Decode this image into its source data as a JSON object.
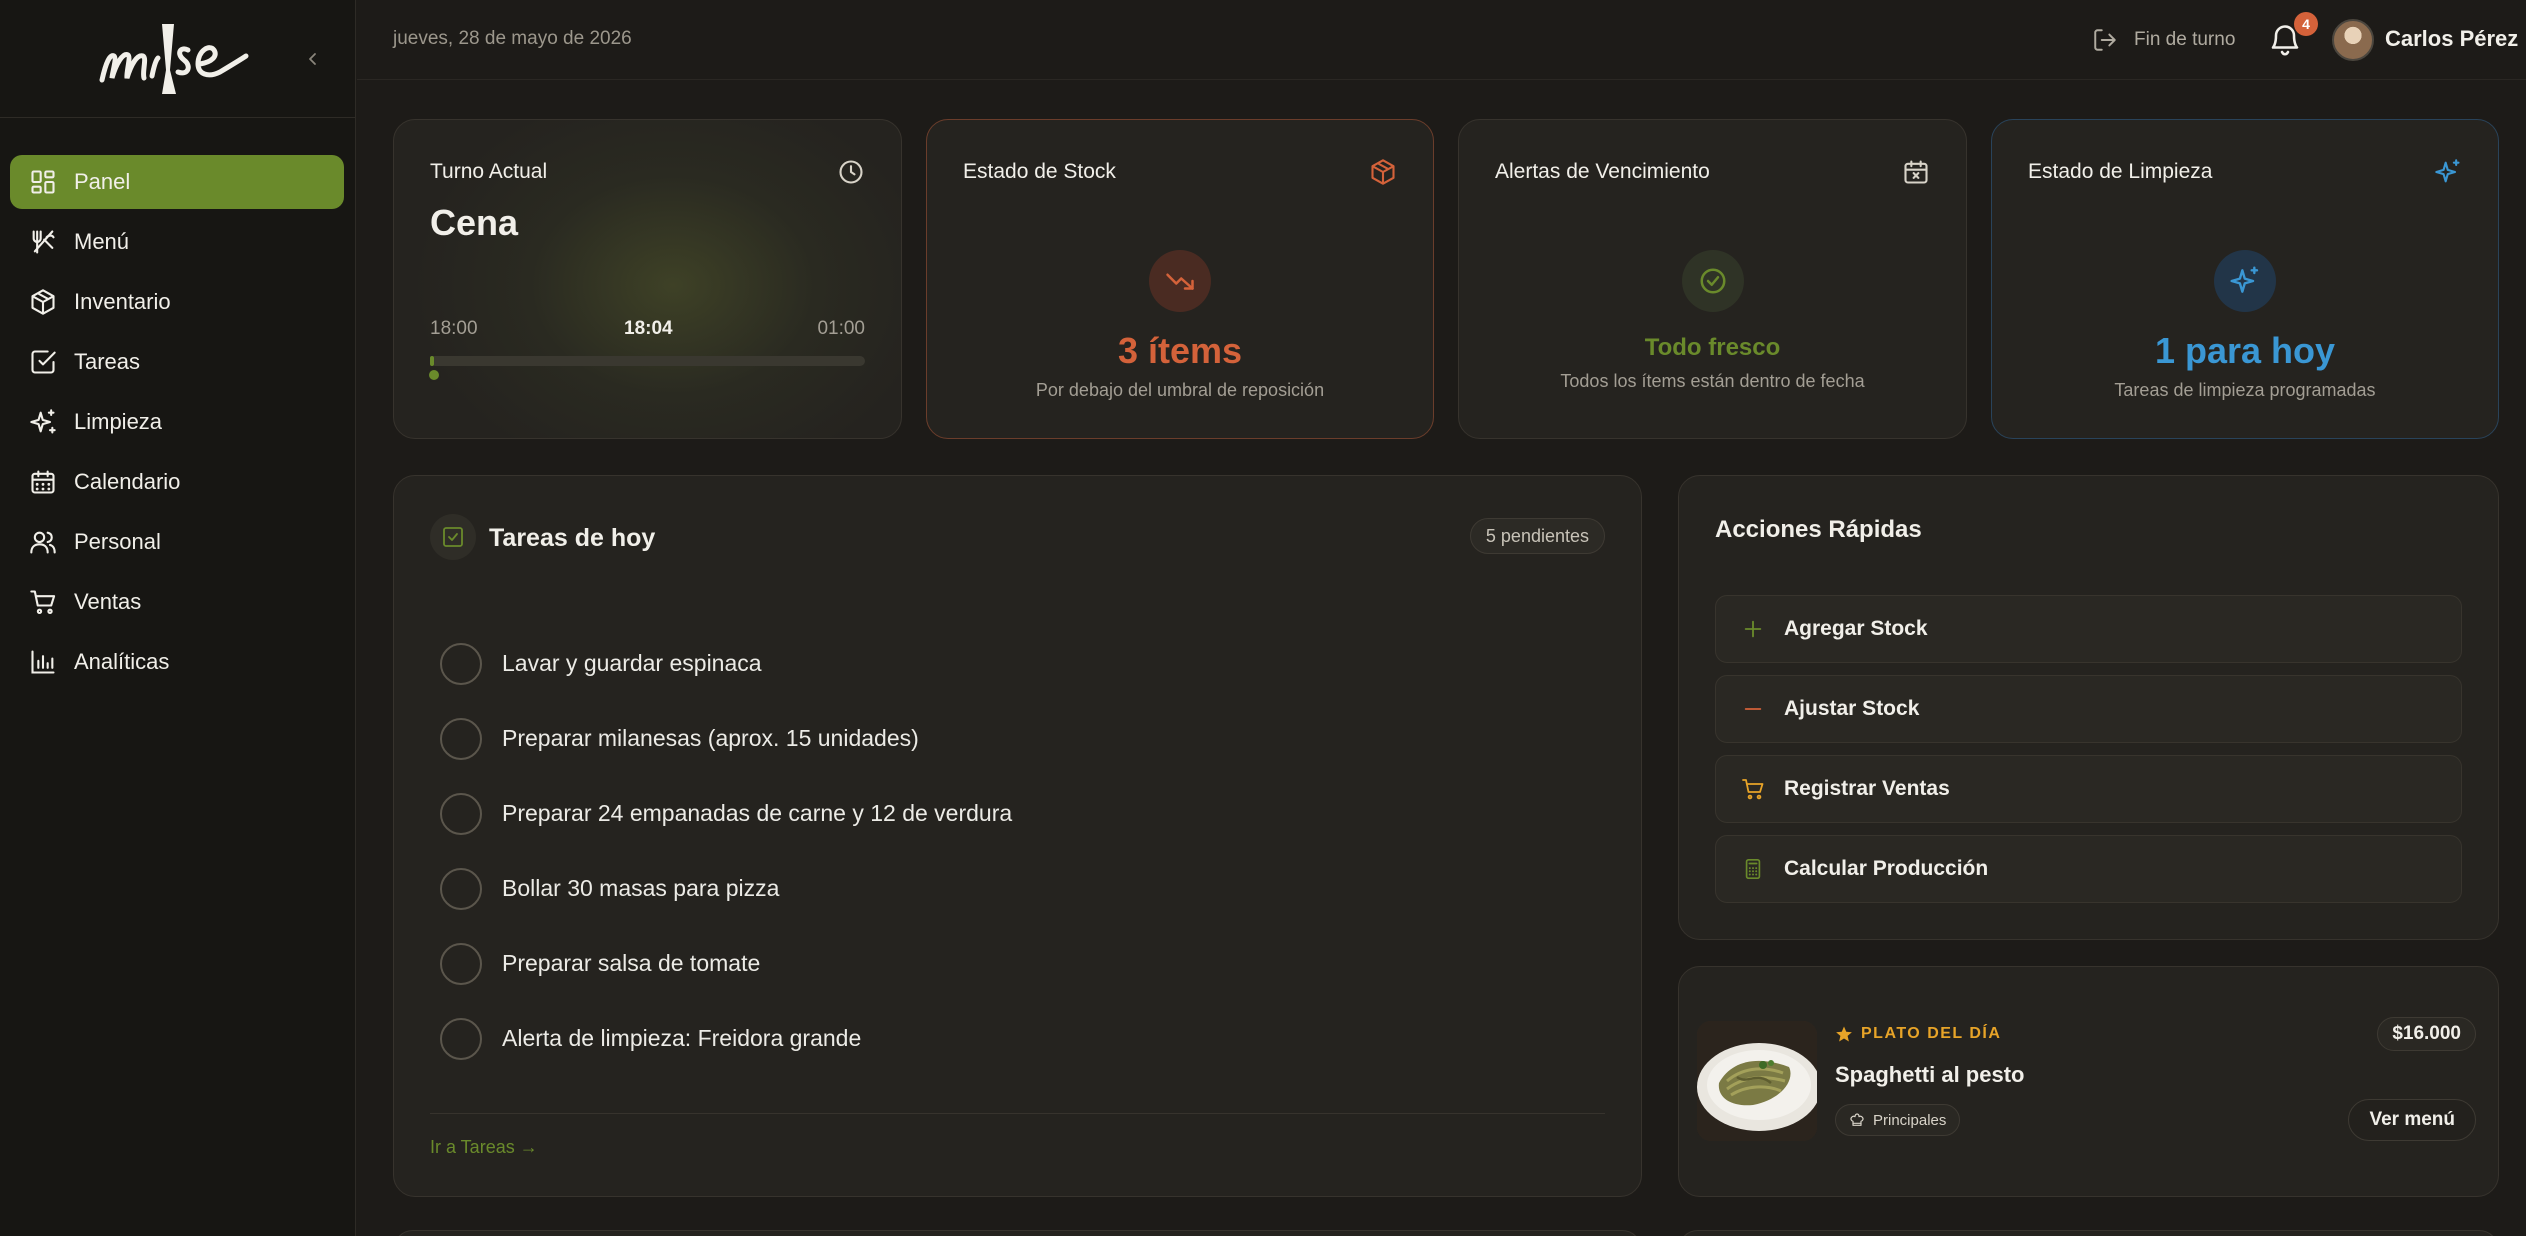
{
  "app": {
    "brand": "mise"
  },
  "sidebar": {
    "items": [
      {
        "label": "Panel",
        "icon": "grid-icon"
      },
      {
        "label": "Menú",
        "icon": "utensils-icon"
      },
      {
        "label": "Inventario",
        "icon": "package-icon"
      },
      {
        "label": "Tareas",
        "icon": "check-square-icon"
      },
      {
        "label": "Limpieza",
        "icon": "sparkles-icon"
      },
      {
        "label": "Calendario",
        "icon": "calendar-icon"
      },
      {
        "label": "Personal",
        "icon": "users-icon"
      },
      {
        "label": "Ventas",
        "icon": "cart-icon"
      },
      {
        "label": "Analíticas",
        "icon": "bar-chart-icon"
      }
    ],
    "active_index": 0
  },
  "topbar": {
    "date": "jueves, 28 de mayo de 2026",
    "end_shift_label": "Fin de turno",
    "notifications_count": "4",
    "user_name": "Carlos Pérez"
  },
  "stats": {
    "shift": {
      "title": "Turno Actual",
      "name": "Cena",
      "start": "18:00",
      "now": "18:04",
      "end": "01:00",
      "progress_fraction": 0.01
    },
    "stock": {
      "title": "Estado de Stock",
      "value": "3 ítems",
      "subtitle": "Por debajo del umbral de reposición"
    },
    "expiry": {
      "title": "Alertas de Vencimiento",
      "value": "Todo fresco",
      "subtitle": "Todos los ítems están dentro de fecha"
    },
    "cleaning": {
      "title": "Estado de Limpieza",
      "value": "1 para hoy",
      "subtitle": "Tareas de limpieza programadas"
    }
  },
  "tasks": {
    "title": "Tareas de hoy",
    "pending": "5 pendientes",
    "items": [
      "Lavar y guardar espinaca",
      "Preparar milanesas (aprox. 15 unidades)",
      "Preparar 24 empanadas de carne y 12 de verdura",
      "Bollar 30 masas para pizza",
      "Preparar salsa de tomate",
      "Alerta de limpieza: Freidora grande"
    ],
    "link": "Ir a Tareas →"
  },
  "quick_actions": {
    "title": "Acciones Rápidas",
    "items": [
      {
        "label": "Agregar Stock",
        "icon": "plus-icon"
      },
      {
        "label": "Ajustar Stock",
        "icon": "minus-icon"
      },
      {
        "label": "Registrar Ventas",
        "icon": "cart-icon"
      },
      {
        "label": "Calcular Producción",
        "icon": "calculator-icon"
      }
    ]
  },
  "dish": {
    "tag": "PLATO DEL DÍA",
    "name": "Spaghetti al pesto",
    "category": "Principales",
    "price": "$16.000",
    "menu_button": "Ver menú"
  },
  "colors": {
    "accent_green": "#6a8a2b",
    "stock_orange": "#d4623a",
    "fresh_green": "#6a8a2b",
    "cleaning_blue": "#3a97d4",
    "dish_gold": "#e8a428"
  }
}
